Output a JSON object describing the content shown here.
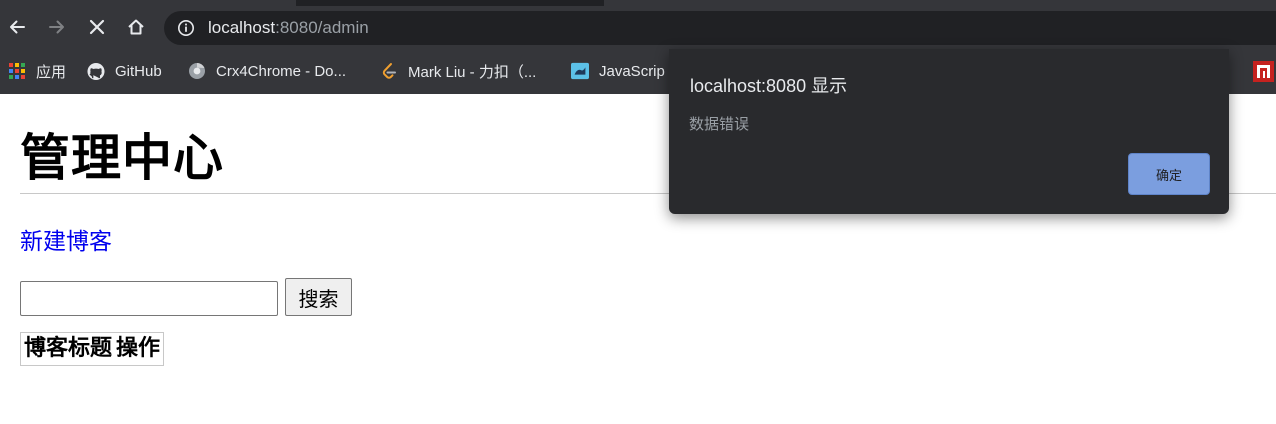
{
  "browser": {
    "url_host": "localhost",
    "url_rest": ":8080/admin",
    "bookmarks": [
      {
        "label": "应用",
        "icon": "apps-grid-icon"
      },
      {
        "label": "GitHub",
        "icon": "github-icon"
      },
      {
        "label": "Crx4Chrome - Do...",
        "icon": "crx4chrome-icon"
      },
      {
        "label": "Mark Liu - 力扣（...",
        "icon": "leetcode-icon"
      },
      {
        "label": "JavaScrip",
        "icon": "javascript-icon"
      }
    ]
  },
  "page": {
    "title": "管理中心",
    "new_blog_link": "新建博客",
    "search": {
      "value": "",
      "button_label": "搜索"
    },
    "table": {
      "headers": [
        "博客标题",
        "操作"
      ],
      "rows": []
    }
  },
  "dialog": {
    "title": "localhost:8080 显示",
    "message": "数据错误",
    "ok_label": "确定"
  },
  "colors": {
    "chrome_toolbar": "#35363a",
    "omnibox": "#202124",
    "dialog_bg": "#292a2d",
    "dialog_button": "#7b9edf",
    "link": "#0000ee"
  }
}
